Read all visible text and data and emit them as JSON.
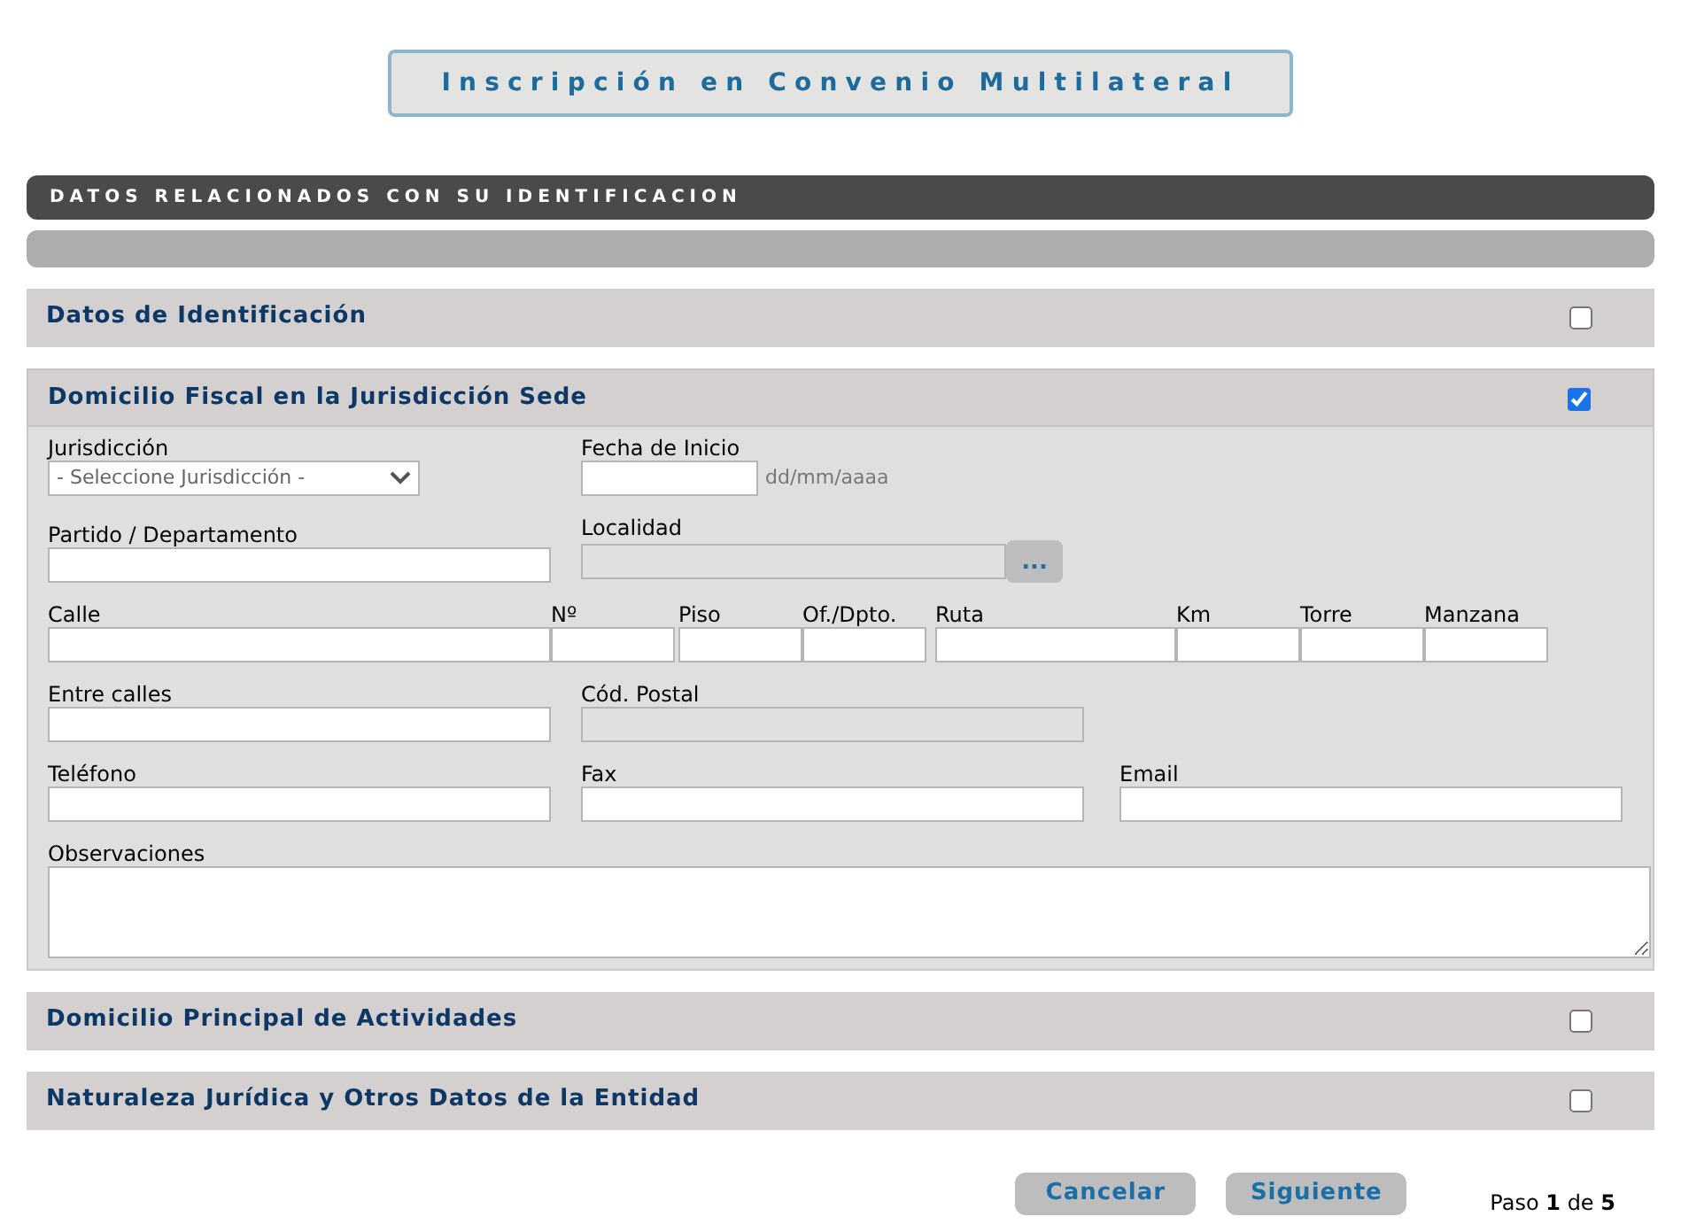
{
  "title": "Inscripción en Convenio Multilateral",
  "banner": "DATOS RELACIONADOS CON SU IDENTIFICACION",
  "sections": [
    {
      "title": "Datos de Identificación",
      "checked": false
    },
    {
      "title": "Domicilio Fiscal en la Jurisdicción Sede",
      "checked": true,
      "rows": [
        [
          {
            "kind": "select",
            "label": "Jurisdicción",
            "value": "- Seleccione Jurisdicción -"
          },
          {
            "kind": "date",
            "label": "Fecha de Inicio",
            "hint": "dd/mm/aaaa"
          }
        ],
        [
          {
            "kind": "text",
            "label": "Partido / Departamento"
          },
          {
            "kind": "lookup",
            "label": "Localidad",
            "button": "..."
          }
        ],
        [
          {
            "kind": "text",
            "label": "Calle"
          },
          {
            "kind": "text",
            "label": "Nº"
          },
          {
            "kind": "text",
            "label": "Piso"
          },
          {
            "kind": "text",
            "label": "Of./Dpto."
          },
          {
            "kind": "text",
            "label": "Ruta"
          },
          {
            "kind": "text",
            "label": "Km"
          },
          {
            "kind": "text",
            "label": "Torre"
          },
          {
            "kind": "text",
            "label": "Manzana"
          }
        ],
        [
          {
            "kind": "text",
            "label": "Entre calles"
          },
          {
            "kind": "readonly",
            "label": "Cód. Postal"
          }
        ],
        [
          {
            "kind": "text",
            "label": "Teléfono"
          },
          {
            "kind": "text",
            "label": "Fax"
          },
          {
            "kind": "text",
            "label": "Email"
          }
        ],
        [
          {
            "kind": "textarea",
            "label": "Observaciones"
          }
        ]
      ]
    },
    {
      "title": "Domicilio Principal de Actividades",
      "checked": false
    },
    {
      "title": "Naturaleza Jurídica y Otros Datos de la Entidad",
      "checked": false
    }
  ],
  "buttons": [
    "Cancelar",
    "Siguiente"
  ],
  "step": "Paso **1** de **5**"
}
